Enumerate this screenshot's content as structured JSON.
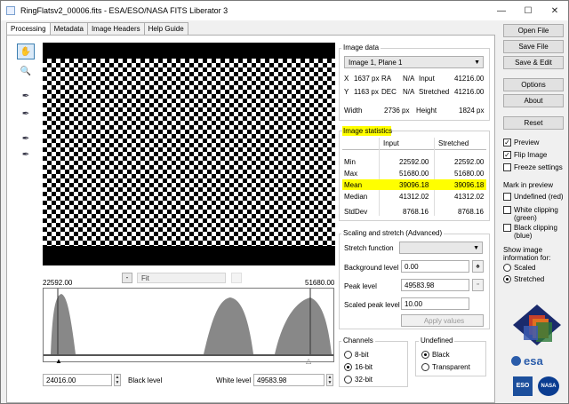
{
  "window": {
    "title": "RingFlatsv2_00006.fits - ESA/ESO/NASA FITS Liberator 3",
    "min": "—",
    "max": "☐",
    "close": "✕"
  },
  "tabs": [
    "Processing",
    "Metadata",
    "Image Headers",
    "Help Guide"
  ],
  "zoom": {
    "minus": "-",
    "value": "Fit"
  },
  "histogram": {
    "min_label": "22592.00",
    "max_label": "51680.00"
  },
  "levels": {
    "black_value": "24016.00",
    "black_label": "Black level",
    "white_label": "White level",
    "white_value": "49583.98"
  },
  "image_data": {
    "heading": "Image data",
    "selector": "Image 1, Plane 1",
    "x_label": "X",
    "x_value": "1637 px",
    "ra_label": "RA",
    "ra_value": "N/A",
    "input_label": "Input",
    "input_value": "41216.00",
    "y_label": "Y",
    "y_value": "1163 px",
    "dec_label": "DEC",
    "dec_value": "N/A",
    "stretched_label": "Stretched",
    "stretched_value": "41216.00",
    "width_label": "Width",
    "width_value": "2736 px",
    "height_label": "Height",
    "height_value": "1824 px"
  },
  "stats": {
    "heading": "Image statistics",
    "col_input": "Input",
    "col_stretched": "Stretched",
    "rows": [
      {
        "name": "Min",
        "input": "22592.00",
        "stretched": "22592.00"
      },
      {
        "name": "Max",
        "input": "51680.00",
        "stretched": "51680.00"
      },
      {
        "name": "Mean",
        "input": "39096.18",
        "stretched": "39096.18"
      },
      {
        "name": "Median",
        "input": "41312.02",
        "stretched": "41312.02"
      },
      {
        "name": "StdDev",
        "input": "8768.16",
        "stretched": "8768.16"
      }
    ]
  },
  "scaling": {
    "heading": "Scaling and stretch (Advanced)",
    "stretch_label": "Stretch function",
    "bg_label": "Background level",
    "bg_value": "0.00",
    "peak_label": "Peak level",
    "peak_value": "49583.98",
    "scaled_label": "Scaled peak level",
    "scaled_value": "10.00",
    "apply": "Apply values"
  },
  "channels": {
    "heading": "Channels",
    "options": [
      "8-bit",
      "16-bit",
      "32-bit"
    ]
  },
  "undefined": {
    "heading": "Undefined",
    "options": [
      "Black",
      "Transparent"
    ]
  },
  "buttons": {
    "open": "Open File",
    "save": "Save File",
    "save_edit": "Save & Edit",
    "options": "Options",
    "about": "About",
    "reset": "Reset"
  },
  "checks": {
    "preview": "Preview",
    "flip": "Flip Image",
    "freeze": "Freeze settings"
  },
  "mark": {
    "heading": "Mark in preview",
    "undefined": "Undefined (red)",
    "white1": "White clipping",
    "white2": "(green)",
    "black1": "Black clipping",
    "black2": "(blue)"
  },
  "show": {
    "h1": "Show image",
    "h2": "information for:",
    "scaled": "Scaled",
    "stretched": "Stretched"
  },
  "logos": {
    "esa": "esa",
    "eso": "ESO",
    "nasa": "NASA"
  }
}
